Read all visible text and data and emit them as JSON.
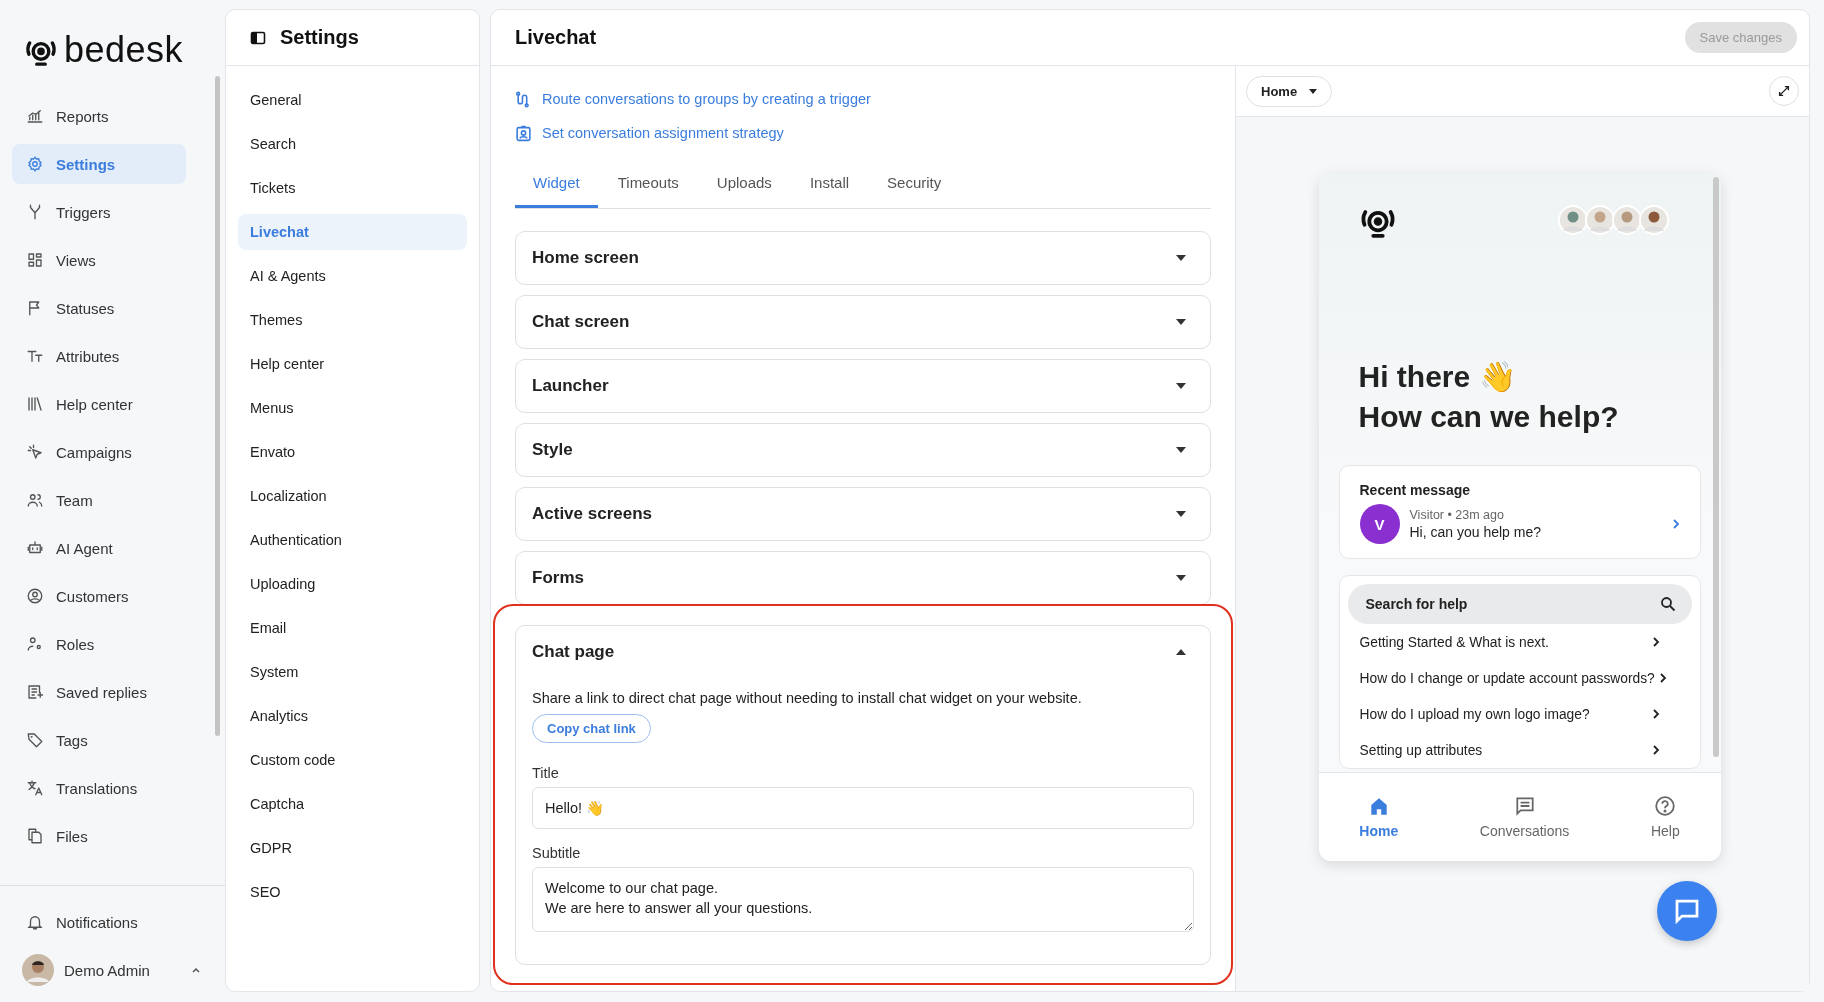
{
  "app": {
    "logo_text": "bedesk"
  },
  "nav": [
    {
      "label": "Reports",
      "selected": false
    },
    {
      "label": "Settings",
      "selected": true
    },
    {
      "label": "Triggers",
      "selected": false
    },
    {
      "label": "Views",
      "selected": false
    },
    {
      "label": "Statuses",
      "selected": false
    },
    {
      "label": "Attributes",
      "selected": false
    },
    {
      "label": "Help center",
      "selected": false
    },
    {
      "label": "Campaigns",
      "selected": false
    },
    {
      "label": "Team",
      "selected": false
    },
    {
      "label": "AI Agent",
      "selected": false
    },
    {
      "label": "Customers",
      "selected": false
    },
    {
      "label": "Roles",
      "selected": false
    },
    {
      "label": "Saved replies",
      "selected": false
    },
    {
      "label": "Tags",
      "selected": false
    },
    {
      "label": "Translations",
      "selected": false
    },
    {
      "label": "Files",
      "selected": false
    }
  ],
  "notifications": "Notifications",
  "user": {
    "name": "Demo Admin"
  },
  "settings": {
    "title": "Settings",
    "items": [
      {
        "label": "General",
        "selected": false
      },
      {
        "label": "Search",
        "selected": false
      },
      {
        "label": "Tickets",
        "selected": false
      },
      {
        "label": "Livechat",
        "selected": true
      },
      {
        "label": "AI & Agents",
        "selected": false
      },
      {
        "label": "Themes",
        "selected": false
      },
      {
        "label": "Help center",
        "selected": false
      },
      {
        "label": "Menus",
        "selected": false
      },
      {
        "label": "Envato",
        "selected": false
      },
      {
        "label": "Localization",
        "selected": false
      },
      {
        "label": "Authentication",
        "selected": false
      },
      {
        "label": "Uploading",
        "selected": false
      },
      {
        "label": "Email",
        "selected": false
      },
      {
        "label": "System",
        "selected": false
      },
      {
        "label": "Analytics",
        "selected": false
      },
      {
        "label": "Custom code",
        "selected": false
      },
      {
        "label": "Captcha",
        "selected": false
      },
      {
        "label": "GDPR",
        "selected": false
      },
      {
        "label": "SEO",
        "selected": false
      }
    ]
  },
  "page": {
    "title": "Livechat",
    "save_button": {
      "label": "Save changes",
      "disabled": true
    },
    "links": [
      "Route conversations to groups by creating a trigger",
      "Set conversation assignment strategy"
    ],
    "tabs": [
      {
        "label": "Widget",
        "selected": true
      },
      {
        "label": "Timeouts",
        "selected": false
      },
      {
        "label": "Uploads",
        "selected": false
      },
      {
        "label": "Install",
        "selected": false
      },
      {
        "label": "Security",
        "selected": false
      }
    ],
    "sections": [
      {
        "title": "Home screen",
        "expanded": false,
        "highlighted": false
      },
      {
        "title": "Chat screen",
        "expanded": false,
        "highlighted": false
      },
      {
        "title": "Launcher",
        "expanded": false,
        "highlighted": false
      },
      {
        "title": "Style",
        "expanded": false,
        "highlighted": false
      },
      {
        "title": "Active screens",
        "expanded": false,
        "highlighted": false
      },
      {
        "title": "Forms",
        "expanded": false,
        "highlighted": false
      },
      {
        "title": "Chat page",
        "expanded": true,
        "highlighted": true,
        "description": "Share a link to direct chat page without needing to install chat widget on your website.",
        "button": "Copy chat link",
        "fields": [
          {
            "kind": "input",
            "label": "Title",
            "value": "Hello! 👋"
          },
          {
            "kind": "textarea",
            "label": "Subtitle",
            "value": "Welcome to our chat page.\nWe are here to answer all your questions."
          }
        ]
      }
    ]
  },
  "preview": {
    "screen_select": "Home",
    "widget": {
      "greeting": "Hi there 👋",
      "headline": "How can we help?",
      "recent": {
        "title": "Recent message",
        "avatar_letter": "V",
        "sender": "Visitor",
        "separator": "•",
        "time": "23m ago",
        "message": "Hi, can you help me?"
      },
      "search_placeholder": "Search for help",
      "articles": [
        "Getting Started & What is next.",
        "How do I change or update account passwords?",
        "How do I upload my own logo image?",
        "Setting up attributes"
      ],
      "bottom_nav": [
        {
          "label": "Home",
          "selected": true
        },
        {
          "label": "Conversations",
          "selected": false
        },
        {
          "label": "Help",
          "selected": false
        }
      ]
    }
  }
}
